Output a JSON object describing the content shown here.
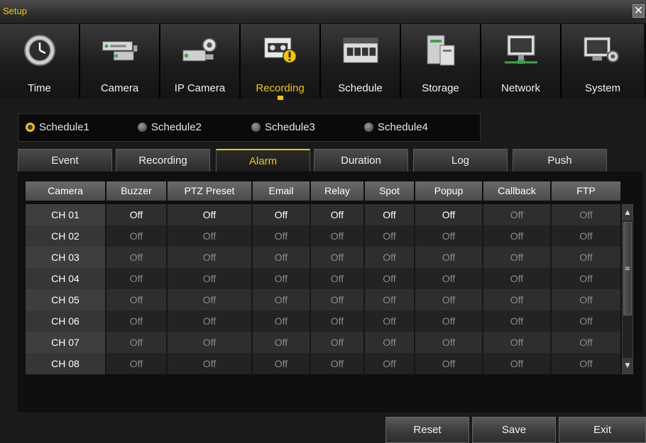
{
  "window": {
    "title": "Setup",
    "close_label": "✕"
  },
  "menu": [
    {
      "label": "Time",
      "icon": "clock-icon",
      "active": false
    },
    {
      "label": "Camera",
      "icon": "camera-icon",
      "active": false
    },
    {
      "label": "IP Camera",
      "icon": "ip-camera-icon",
      "active": false
    },
    {
      "label": "Recording",
      "icon": "recording-icon",
      "active": true
    },
    {
      "label": "Schedule",
      "icon": "schedule-icon",
      "active": false
    },
    {
      "label": "Storage",
      "icon": "storage-icon",
      "active": false
    },
    {
      "label": "Network",
      "icon": "network-icon",
      "active": false
    },
    {
      "label": "System",
      "icon": "system-icon",
      "active": false
    }
  ],
  "schedules": [
    {
      "label": "Schedule1",
      "selected": true
    },
    {
      "label": "Schedule2",
      "selected": false
    },
    {
      "label": "Schedule3",
      "selected": false
    },
    {
      "label": "Schedule4",
      "selected": false
    }
  ],
  "tabs": [
    {
      "label": "Event",
      "active": false
    },
    {
      "label": "Recording",
      "active": false
    },
    {
      "label": "Alarm",
      "active": true
    },
    {
      "label": "Duration",
      "active": false
    },
    {
      "label": "Log",
      "active": false
    },
    {
      "label": "Push",
      "active": false
    }
  ],
  "table": {
    "headers": [
      "Camera",
      "Buzzer",
      "PTZ Preset",
      "Email",
      "Relay",
      "Spot",
      "Popup",
      "Callback",
      "FTP"
    ],
    "rows": [
      [
        "CH 01",
        "Off",
        "Off",
        "Off",
        "Off",
        "Off",
        "Off",
        "Off",
        "Off"
      ],
      [
        "CH 02",
        "Off",
        "Off",
        "Off",
        "Off",
        "Off",
        "Off",
        "Off",
        "Off"
      ],
      [
        "CH 03",
        "Off",
        "Off",
        "Off",
        "Off",
        "Off",
        "Off",
        "Off",
        "Off"
      ],
      [
        "CH 04",
        "Off",
        "Off",
        "Off",
        "Off",
        "Off",
        "Off",
        "Off",
        "Off"
      ],
      [
        "CH 05",
        "Off",
        "Off",
        "Off",
        "Off",
        "Off",
        "Off",
        "Off",
        "Off"
      ],
      [
        "CH 06",
        "Off",
        "Off",
        "Off",
        "Off",
        "Off",
        "Off",
        "Off",
        "Off"
      ],
      [
        "CH 07",
        "Off",
        "Off",
        "Off",
        "Off",
        "Off",
        "Off",
        "Off",
        "Off"
      ],
      [
        "CH 08",
        "Off",
        "Off",
        "Off",
        "Off",
        "Off",
        "Off",
        "Off",
        "Off"
      ]
    ]
  },
  "buttons": {
    "reset": "Reset",
    "save": "Save",
    "exit": "Exit"
  },
  "colors": {
    "accent": "#f4c600",
    "text": "#ffffff",
    "dim_text": "#8a8a8a"
  }
}
